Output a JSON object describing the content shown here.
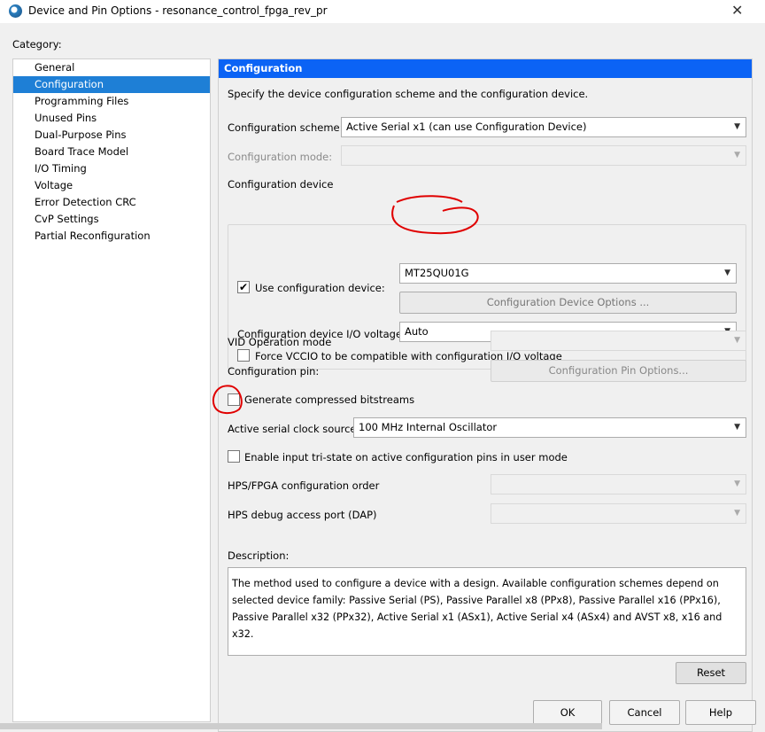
{
  "window": {
    "title": "Device and Pin Options - resonance_control_fpga_rev_pr",
    "close": "✕"
  },
  "category": {
    "label": "Category:",
    "items": [
      "General",
      "Configuration",
      "Programming Files",
      "Unused Pins",
      "Dual-Purpose Pins",
      "Board Trace Model",
      "I/O Timing",
      "Voltage",
      "Error Detection CRC",
      "CvP Settings",
      "Partial Reconfiguration"
    ],
    "selected": "Configuration"
  },
  "panel": {
    "title": "Configuration",
    "intro": "Specify the device configuration scheme and the configuration device.",
    "scheme_label": "Configuration scheme:",
    "scheme_value": "Active Serial x1 (can use Configuration Device)",
    "mode_label": "Configuration mode:",
    "mode_value": "",
    "device_group": "Configuration device",
    "use_device_label": "Use configuration device:",
    "use_device_checked": true,
    "device_value": "MT25QU01G",
    "device_options_button": "Configuration Device Options ...",
    "io_voltage_label": "Configuration device I/O voltage:",
    "io_voltage_value": "Auto",
    "force_vccio_label": "Force VCCIO to be compatible with configuration I/O voltage",
    "force_vccio_checked": false,
    "vid_label": "VID Operation mode",
    "pin_label": "Configuration pin:",
    "pin_button": "Configuration Pin Options...",
    "compress_label": "Generate compressed bitstreams",
    "compress_checked": false,
    "clock_label": "Active serial clock source:",
    "clock_value": "100 MHz Internal Oscillator",
    "tristate_label": "Enable input tri-state on active configuration pins in user mode",
    "tristate_checked": false,
    "hps_order_label": "HPS/FPGA configuration order",
    "hps_dap_label": "HPS debug access port (DAP)",
    "description_label": "Description:",
    "description": "The method used to configure a device with a design. Available configuration schemes depend on selected device family: Passive Serial (PS), Passive Parallel x8 (PPx8), Passive Parallel x16 (PPx16), Passive Parallel x32 (PPx32), Active Serial x1 (ASx1), Active Serial x4 (ASx4) and AVST x8, x16 and x32.",
    "reset_button": "Reset"
  },
  "footer": {
    "ok": "OK",
    "cancel": "Cancel",
    "help": "Help"
  },
  "colors": {
    "header": "#0b63f5",
    "selection": "#1e7fd6",
    "annotation": "#e00000"
  }
}
